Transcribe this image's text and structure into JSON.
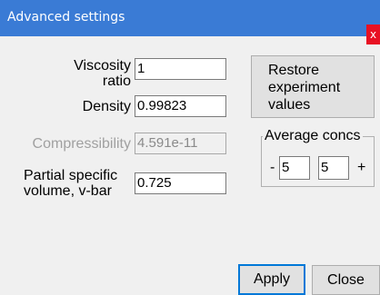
{
  "window": {
    "title": "Advanced settings",
    "close_label": "x"
  },
  "fields": {
    "viscosity_label": "Viscosity ratio",
    "viscosity_value": "1",
    "density_label": "Density",
    "density_value": "0.99823",
    "compressibility_label": "Compressibility",
    "compressibility_value": "4.591e-11",
    "vbar_label": "Partial specific volume, v-bar",
    "vbar_value": "0.725"
  },
  "restore_button": {
    "label": "Restore experiment values"
  },
  "average_concs": {
    "title": "Average concs",
    "minus_label": "-",
    "plus_label": "+",
    "value1": "5",
    "value2": "5"
  },
  "buttons": {
    "apply_label": "Apply",
    "close_label": "Close"
  }
}
